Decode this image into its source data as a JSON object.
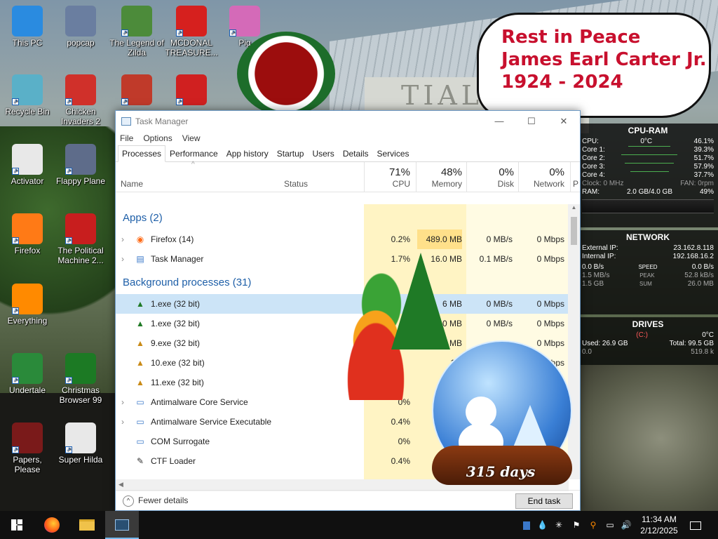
{
  "desktop_icons": [
    {
      "label": "This PC",
      "icon": "computer-icon",
      "color": "#2a8be0"
    },
    {
      "label": "popcap",
      "icon": "folder-icon",
      "color": "#6a7ea0"
    },
    {
      "label": "The Legend of Zilda",
      "icon": "game-icon",
      "color": "#4c8b3a"
    },
    {
      "label": "MCDONAL TREASURE...",
      "icon": "mcdonalds-icon",
      "color": "#d6201e"
    },
    {
      "label": "Pig",
      "icon": "pig-icon",
      "color": "#d46ab8"
    },
    {
      "label": "Recycle Bin",
      "icon": "recycle-bin-icon",
      "color": "#5ab0c8"
    },
    {
      "label": "Chicken Invaders 2",
      "icon": "chicken-icon",
      "color": "#d0302a"
    },
    {
      "label": "",
      "icon": "angry-bird-icon",
      "color": "#c03a2a"
    },
    {
      "label": "",
      "icon": "snowman-icon",
      "color": "#d02020"
    },
    {
      "label": "Activator",
      "icon": "file-icon",
      "color": "#e8e8e8"
    },
    {
      "label": "Flappy Plane",
      "icon": "plane-icon",
      "color": "#5e6c8a"
    },
    {
      "label": "Firefox",
      "icon": "firefox-icon",
      "color": "#ff7a16"
    },
    {
      "label": "The Political Machine 2...",
      "icon": "political-icon",
      "color": "#c81e1e"
    },
    {
      "label": "Everything",
      "icon": "search-icon",
      "color": "#ff8a00"
    },
    {
      "label": "Undertale",
      "icon": "undertale-icon",
      "color": "#2a8a3a"
    },
    {
      "label": "Christmas Browser 99",
      "icon": "christmas-tree-icon",
      "color": "#1c7a24"
    },
    {
      "label": "Papers, Please",
      "icon": "papers-icon",
      "color": "#7a1a1a"
    },
    {
      "label": "Super Hilda",
      "icon": "hilda-icon",
      "color": "#e8e8e8"
    }
  ],
  "bubble": {
    "line1": "Rest in Peace",
    "line2": "James Earl Carter Jr.",
    "line3": "1924 - 2024"
  },
  "gadget_cpu": {
    "title": "CPU-RAM",
    "cpu_label": "CPU:",
    "cpu_temp": "0°C",
    "cpu_pct": "46.1%",
    "cores": [
      {
        "label": "Core 1:",
        "pct": "39.3%"
      },
      {
        "label": "Core 2:",
        "pct": "51.7%"
      },
      {
        "label": "Core 3:",
        "pct": "57.9%"
      },
      {
        "label": "Core 4:",
        "pct": "37.7%"
      }
    ],
    "clock": "Clock: 0 MHz",
    "fan": "FAN: 0rpm",
    "ram_label": "RAM:",
    "ram_value": "2.0 GB/4.0 GB",
    "ram_pct": "49%"
  },
  "gadget_net": {
    "title": "NETWORK",
    "ext_label": "External IP:",
    "ext_ip": "23.162.8.118",
    "int_label": "Internal IP:",
    "int_ip": "192.168.16.2",
    "speed_in": "0.0 B/s",
    "speed_label": "SPEED",
    "speed_out": "0.0 B/s",
    "peak_in": "1.5 MB/s",
    "peak_label": "PEAK",
    "peak_out": "52.8 kB/s",
    "sum_in": "1.5 GB",
    "sum_label": "SUM",
    "sum_out": "26.0 MB"
  },
  "gadget_drives": {
    "title": "DRIVES",
    "drive": "(C:)",
    "temp": "0°C",
    "used": "Used: 26.9 GB",
    "total": "Total: 99.5 GB",
    "read": "0.0",
    "write": "519.8 k"
  },
  "task_manager": {
    "title": "Task Manager",
    "window_buttons": {
      "minimize": "—",
      "maximize": "☐",
      "close": "✕"
    },
    "menu": [
      "File",
      "Options",
      "View"
    ],
    "tabs": [
      "Processes",
      "Performance",
      "App history",
      "Startup",
      "Users",
      "Details",
      "Services"
    ],
    "active_tab": "Processes",
    "columns": {
      "name": "Name",
      "status": "Status",
      "cpu_pct": "71%",
      "cpu": "CPU",
      "mem_pct": "48%",
      "memory": "Memory",
      "disk_pct": "0%",
      "disk": "Disk",
      "net_pct": "0%",
      "network": "Network",
      "next": "P"
    },
    "apps_header": "Apps (2)",
    "apps": [
      {
        "name": "Firefox (14)",
        "icon": "firefox-icon",
        "cpu": "0.2%",
        "memory": "489.0 MB",
        "disk": "0 MB/s",
        "network": "0 Mbps"
      },
      {
        "name": "Task Manager",
        "icon": "task-manager-icon",
        "cpu": "1.7%",
        "memory": "16.0 MB",
        "disk": "0.1 MB/s",
        "network": "0 Mbps"
      }
    ],
    "bg_header": "Background processes (31)",
    "background": [
      {
        "name": "1.exe (32 bit)",
        "icon": "christmas-tree-icon",
        "cpu": "",
        "memory": "6 MB",
        "disk": "0 MB/s",
        "network": "0 Mbps"
      },
      {
        "name": "1.exe (32 bit)",
        "icon": "christmas-tree-icon",
        "cpu": "",
        "memory": "0 MB",
        "disk": "0 MB/s",
        "network": "0 Mbps"
      },
      {
        "name": "9.exe (32 bit)",
        "icon": "bell-icon",
        "cpu": "",
        "memory": "2.2 MB",
        "disk": "",
        "network": "0 Mbps"
      },
      {
        "name": "10.exe (32 bit)",
        "icon": "bell-icon",
        "cpu": "",
        "memory": "1.3",
        "disk": "",
        "network": "bps"
      },
      {
        "name": "11.exe (32 bit)",
        "icon": "bell-icon",
        "cpu": "",
        "memory": "",
        "disk": "",
        "network": ""
      },
      {
        "name": "Antimalware Core Service",
        "icon": "service-icon",
        "cpu": "0%",
        "memory": "",
        "disk": "",
        "network": ""
      },
      {
        "name": "Antimalware Service Executable",
        "icon": "service-icon",
        "cpu": "0.4%",
        "memory": "1",
        "disk": "",
        "network": ""
      },
      {
        "name": "COM Surrogate",
        "icon": "service-icon",
        "cpu": "0%",
        "memory": "",
        "disk": "",
        "network": ""
      },
      {
        "name": "CTF Loader",
        "icon": "pen-icon",
        "cpu": "0.4%",
        "memory": "2",
        "disk": "",
        "network": ""
      }
    ],
    "fewer_details": "Fewer details",
    "end_task": "End task"
  },
  "globe": {
    "days": "315 days"
  },
  "wallpaper_text": "TIAL",
  "taskbar": {
    "time": "11:34 AM",
    "date": "2/12/2025",
    "start_icon": "windows-start-icon"
  },
  "colors": {
    "accent": "#1e5fa8",
    "cpu_highlight": "#fff4c4",
    "mem_highlight": "#ffe08a",
    "bubble_text": "#c8102e"
  }
}
